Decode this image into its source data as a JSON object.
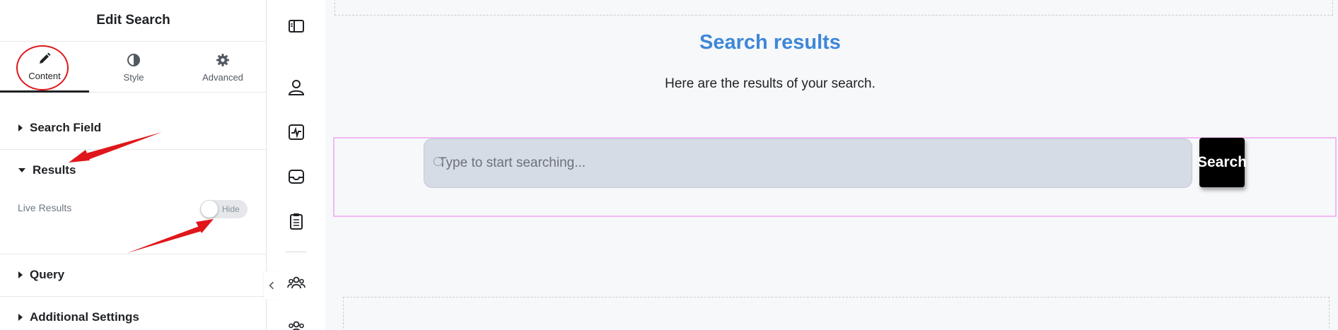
{
  "panel": {
    "title": "Edit Search",
    "tabs": [
      {
        "label": "Content",
        "icon": "pencil-icon",
        "active": true
      },
      {
        "label": "Style",
        "icon": "half-circle-icon",
        "active": false
      },
      {
        "label": "Advanced",
        "icon": "gear-icon",
        "active": false
      }
    ],
    "sections": {
      "search_field": "Search Field",
      "results": "Results",
      "query": "Query",
      "additional_settings": "Additional Settings"
    },
    "live_results": {
      "label": "Live Results",
      "toggle_text": "Hide",
      "enabled": false
    }
  },
  "strip": {
    "icons": [
      "sidebar-toggle-icon",
      "user-icon",
      "activity-icon",
      "inbox-icon",
      "clipboard-icon",
      "users-icon",
      "users-icon"
    ]
  },
  "canvas": {
    "title": "Search results",
    "subtitle": "Here are the results of your search.",
    "search_placeholder": "Type to start searching...",
    "search_button": "Search"
  },
  "colors": {
    "accent_title": "#3d87d8",
    "annotation": "#e0161b",
    "selection_frame": "#f2b8f5"
  }
}
